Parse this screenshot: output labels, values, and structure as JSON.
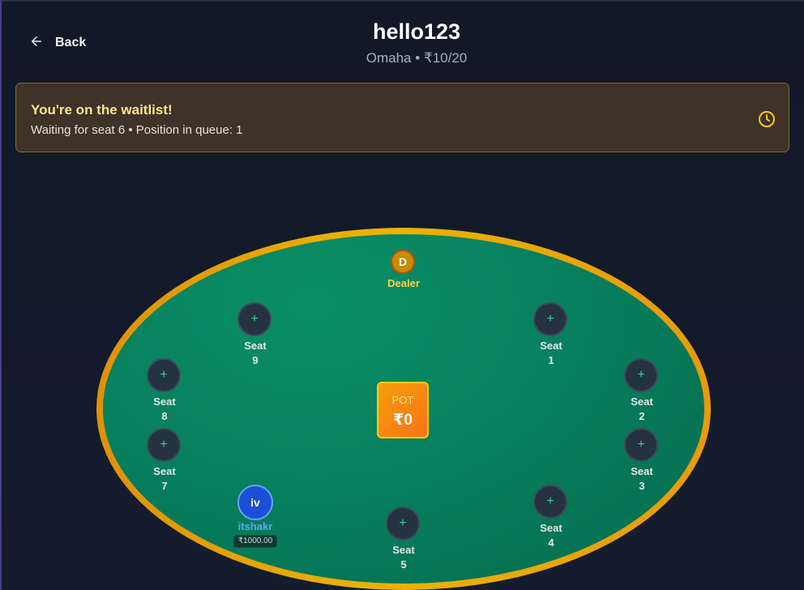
{
  "header": {
    "back_label": "Back",
    "title": "hello123",
    "subtitle": "Omaha • ₹10/20"
  },
  "waitlist": {
    "title": "You're on the waitlist!",
    "text": "Waiting for seat 6 • Position in queue: 1",
    "icon": "clock-icon"
  },
  "table": {
    "dealer_chip": "D",
    "dealer_label": "Dealer",
    "pot_label": "POT",
    "pot_value": "₹0",
    "seat_word": "Seat",
    "seat_plus": "+",
    "seats": [
      {
        "number": "1"
      },
      {
        "number": "2"
      },
      {
        "number": "3"
      },
      {
        "number": "4"
      },
      {
        "number": "5"
      },
      {
        "number": "7"
      },
      {
        "number": "8"
      },
      {
        "number": "9"
      }
    ],
    "player": {
      "initials": "iv",
      "name": "itshakr",
      "stack": "₹1000.00"
    }
  },
  "colors": {
    "felt": "#07805d",
    "rail": "#eab308",
    "banner_bg": "#3f3228",
    "banner_title": "#fde68a",
    "player_accent": "#60a5fa"
  }
}
